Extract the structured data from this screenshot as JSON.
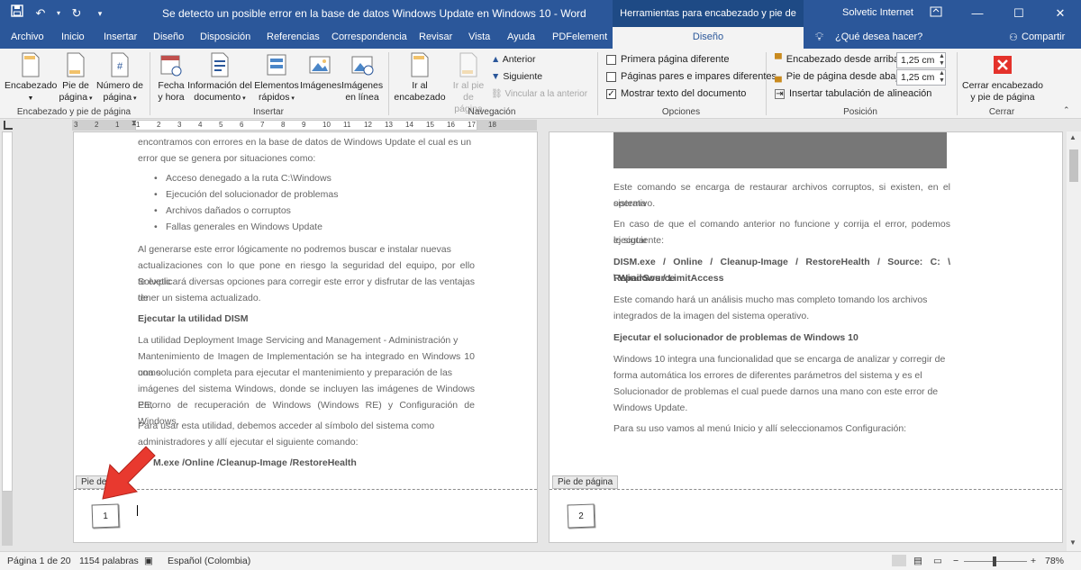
{
  "window": {
    "title": "Se detecto un posible error en la base de datos Windows Update en Windows 10  -  Word",
    "context_tab_title": "Herramientas para encabezado y pie de página",
    "user": "Solvetic Internet"
  },
  "tabs": [
    "Archivo",
    "Inicio",
    "Insertar",
    "Diseño",
    "Disposición",
    "Referencias",
    "Correspondencia",
    "Revisar",
    "Vista",
    "Ayuda",
    "PDFelement"
  ],
  "active_tab": "Diseño",
  "tell_me": "¿Qué desea hacer?",
  "share": "Compartir",
  "ribbon": {
    "header_footer_group": {
      "label": "Encabezado y pie de página",
      "encabezado": "Encabezado",
      "pie_1": "Pie de",
      "pie_2": "página",
      "numero_1": "Número de",
      "numero_2": "página"
    },
    "insert_group": {
      "label": "Insertar",
      "fecha_1": "Fecha",
      "fecha_2": "y hora",
      "info_1": "Información del",
      "info_2": "documento",
      "elementos_1": "Elementos",
      "elementos_2": "rápidos",
      "imagenes": "Imágenes",
      "img_linea_1": "Imágenes",
      "img_linea_2": "en línea"
    },
    "navigation_group": {
      "label": "Navegación",
      "ir_enc_1": "Ir al",
      "ir_enc_2": "encabezado",
      "ir_pie_1": "Ir al pie",
      "ir_pie_2": "de página",
      "anterior": "Anterior",
      "siguiente": "Siguiente",
      "vincular": "Vincular a la anterior"
    },
    "options_group": {
      "label": "Opciones",
      "primera": "Primera página diferente",
      "pares": "Páginas pares e impares diferentes",
      "mostrar": "Mostrar texto del documento",
      "mostrar_checked": true
    },
    "position_group": {
      "label": "Posición",
      "enc_label": "Encabezado desde arriba:",
      "enc_value": "1,25 cm",
      "pie_label": "Pie de página desde abajo:",
      "pie_value": "1,25 cm",
      "tab_label": "Insertar tabulación de alineación"
    },
    "close_group": {
      "label": "Cerrar",
      "close_1": "Cerrar encabezado",
      "close_2": "y pie de página"
    }
  },
  "ruler_numbers": [
    "3",
    "2",
    "1",
    "1",
    "2",
    "3",
    "4",
    "5",
    "6",
    "7",
    "8",
    "9",
    "10",
    "11",
    "12",
    "13",
    "14",
    "15",
    "16",
    "17",
    "18"
  ],
  "page1": {
    "lines": [
      "encontramos con errores en la base de datos de Windows Update el cual es un",
      "error que se genera por situaciones como:"
    ],
    "bullets": [
      "Acceso denegado a la ruta C:\\Windows",
      "Ejecución del solucionador de problemas",
      "Archivos dañados o corruptos",
      "Fallas generales en Windows Update"
    ],
    "para1": [
      "Al generarse este error lógicamente no podremos buscar e instalar nuevas",
      "actualizaciones con lo que pone en riesgo la seguridad del equipo, por ello Solvetic",
      "te explicará diversas opciones para corregir este error y disfrutar de las ventajas de",
      "tener un sistema actualizado."
    ],
    "heading": "Ejecutar la utilidad DISM",
    "para2": [
      "La utilidad Deployment Image Servicing and Management - Administración y",
      "Mantenimiento de Imagen de Implementación se ha integrado en Windows 10 como",
      "una solución completa para ejecutar el mantenimiento y preparación de las",
      "imágenes del sistema Windows, donde se incluyen las imágenes de Windows PE,",
      "Entorno de recuperación de Windows (Windows RE) y Configuración de Windows."
    ],
    "para3": [
      "Para usar esta utilidad, debemos acceder al símbolo del sistema como",
      "administradores y allí ejecutar el siguiente comando:"
    ],
    "command": "M.exe /Online /Cleanup-Image /RestoreHealth",
    "footer_label": "Pie de p",
    "page_number": "1"
  },
  "page2": {
    "para1": [
      "Este comando se encarga de restaurar archivos corruptos, si existen, en el sistema",
      "operativo."
    ],
    "para2": [
      "En caso de que el comando anterior no funcione y corrija el error, podemos ejecutar",
      "lo siguiente:"
    ],
    "command": [
      "DISM.exe / Online / Cleanup-Image / RestoreHealth / Source: C: \\ RepairSource",
      "\\ Windows / LimitAccess"
    ],
    "para3": [
      "Este comando hará un análisis mucho mas completo tomando los archivos",
      "integrados de la imagen del sistema operativo."
    ],
    "heading": "Ejecutar el solucionador de problemas de Windows 10",
    "para4": [
      "Windows 10 integra una funcionalidad que se encarga de analizar y corregir de",
      "forma automática los errores de diferentes parámetros del sistema y es el",
      "Solucionador de problemas el cual puede darnos una mano con este error de",
      "Windows Update."
    ],
    "para5": "Para su uso vamos al menú Inicio y allí seleccionamos Configuración:",
    "footer_label": "Pie de página",
    "page_number": "2"
  },
  "status": {
    "page": "Página 1 de 20",
    "words": "1154 palabras",
    "language": "Español (Colombia)",
    "zoom": "78%"
  },
  "colors": {
    "accent": "#2b579a",
    "arrow": "#e8392f",
    "close": "#e4322b"
  }
}
